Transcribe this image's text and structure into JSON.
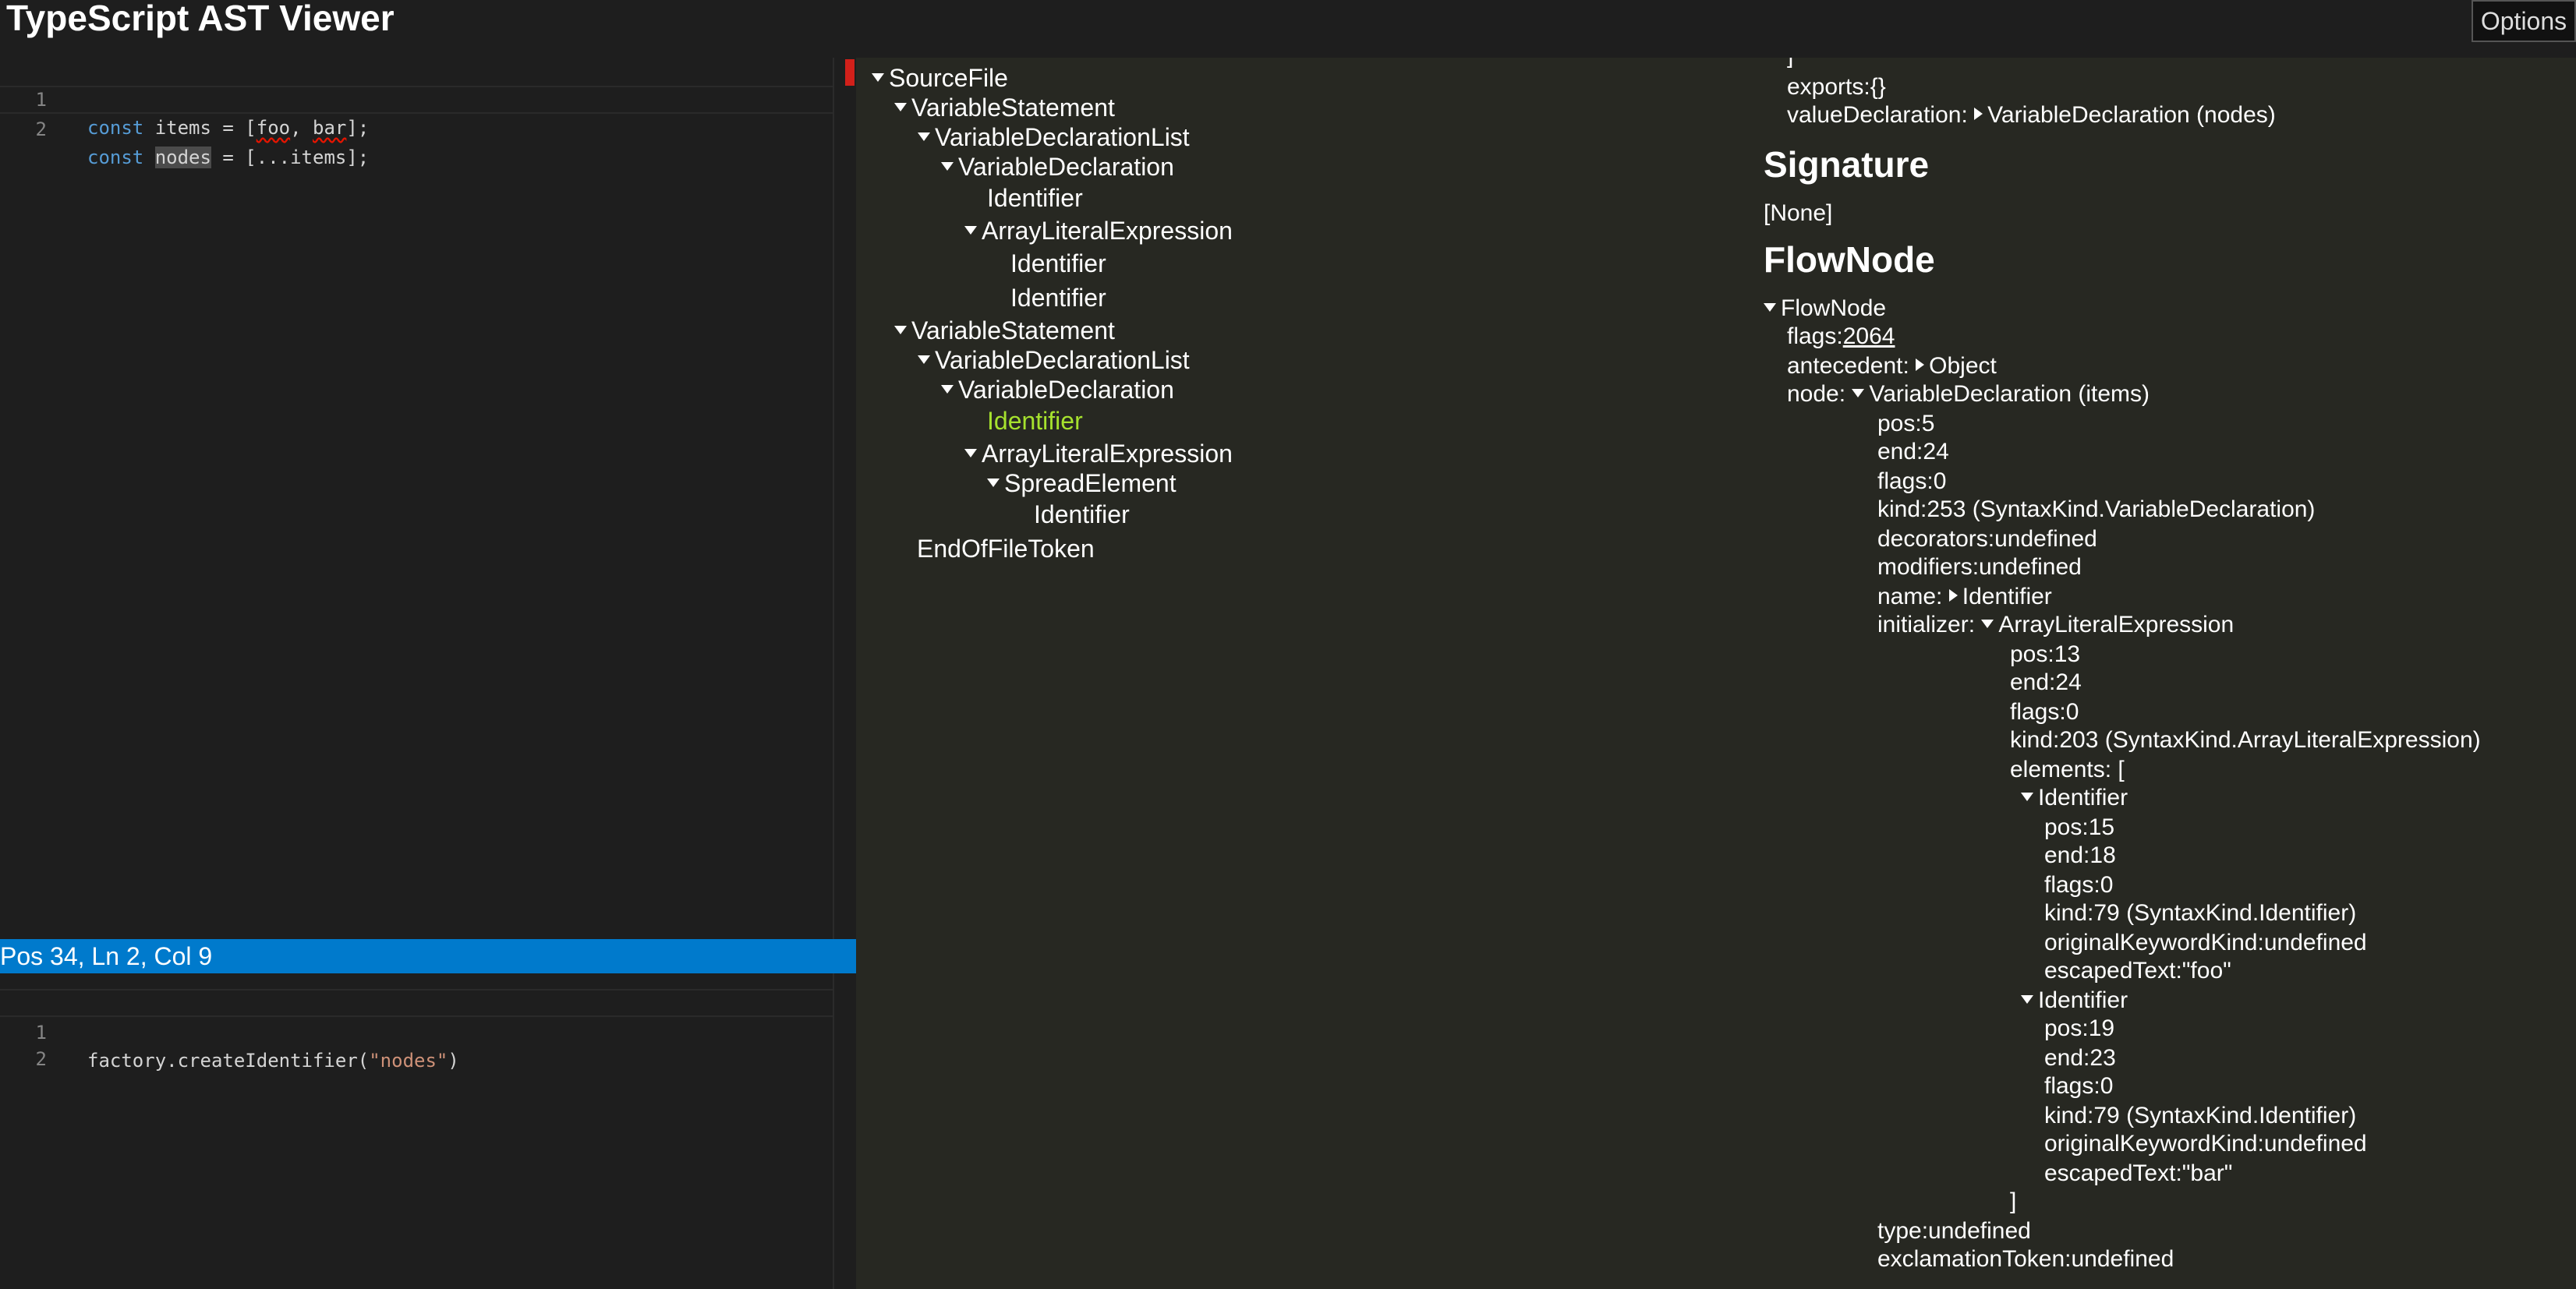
{
  "app": {
    "title": "TypeScript AST Viewer",
    "options_label": "Options"
  },
  "code_editor": {
    "lines": [
      {
        "num": "1",
        "kw": "const",
        "rest_a": " items = [",
        "id1": "foo",
        "sep": ", ",
        "id2": "bar",
        "end": "];"
      },
      {
        "num": "2",
        "kw": "const",
        "sp": " ",
        "hl": "nodes",
        "rest": " = [...items];"
      }
    ]
  },
  "status": {
    "position": "Pos 34, Ln 2, Col 9"
  },
  "factory_editor": {
    "lines": [
      {
        "num": "1",
        "call": "factory.createIdentifier(",
        "str": "\"nodes\"",
        "close": ")"
      },
      {
        "num": "2"
      }
    ]
  },
  "tree": {
    "nodes": [
      "SourceFile",
      "VariableStatement",
      "VariableDeclarationList",
      "VariableDeclaration",
      "Identifier",
      "ArrayLiteralExpression",
      "Identifier",
      "Identifier",
      "VariableStatement",
      "VariableDeclarationList",
      "VariableDeclaration",
      "Identifier",
      "ArrayLiteralExpression",
      "SpreadElement",
      "Identifier",
      "EndOfFileToken"
    ],
    "selected_index": 11
  },
  "props": {
    "top_bracket": "]",
    "exports_key": "exports:",
    "exports_val": "{}",
    "value_decl_key": "valueDeclaration:",
    "value_decl_val": "VariableDeclaration (nodes)",
    "signature_heading": "Signature",
    "signature_val": "[None]",
    "flownode_heading": "FlowNode",
    "flownode_root": "FlowNode",
    "flags_key": "flags:",
    "flags_val": "2064",
    "antecedent_key": "antecedent:",
    "antecedent_val": "Object",
    "node_key": "node:",
    "node_val": "VariableDeclaration (items)",
    "node_props": [
      {
        "k": "pos:",
        "v": "5"
      },
      {
        "k": "end:",
        "v": "24"
      },
      {
        "k": "flags:",
        "v": "0"
      },
      {
        "k": "kind:",
        "v": "253 (SyntaxKind.VariableDeclaration)"
      },
      {
        "k": "decorators:",
        "v": "undefined"
      },
      {
        "k": "modifiers:",
        "v": "undefined"
      }
    ],
    "name_key": "name:",
    "name_val": "Identifier",
    "initializer_key": "initializer:",
    "initializer_val": "ArrayLiteralExpression",
    "init_props": [
      {
        "k": "pos:",
        "v": "13"
      },
      {
        "k": "end:",
        "v": "24"
      },
      {
        "k": "flags:",
        "v": "0"
      },
      {
        "k": "kind:",
        "v": "203 (SyntaxKind.ArrayLiteralExpression)"
      }
    ],
    "elements_open": "elements: [",
    "elements": [
      {
        "label": "Identifier",
        "props": [
          {
            "k": "pos:",
            "v": "15"
          },
          {
            "k": "end:",
            "v": "18"
          },
          {
            "k": "flags:",
            "v": "0"
          },
          {
            "k": "kind:",
            "v": "79 (SyntaxKind.Identifier)"
          },
          {
            "k": "originalKeywordKind:",
            "v": "undefined"
          },
          {
            "k": "escapedText:",
            "v": "\"foo\""
          }
        ]
      },
      {
        "label": "Identifier",
        "props": [
          {
            "k": "pos:",
            "v": "19"
          },
          {
            "k": "end:",
            "v": "23"
          },
          {
            "k": "flags:",
            "v": "0"
          },
          {
            "k": "kind:",
            "v": "79 (SyntaxKind.Identifier)"
          },
          {
            "k": "originalKeywordKind:",
            "v": "undefined"
          },
          {
            "k": "escapedText:",
            "v": "\"bar\""
          }
        ]
      }
    ],
    "elements_close": "]",
    "tail_props": [
      {
        "k": "type:",
        "v": "undefined"
      },
      {
        "k": "exclamationToken:",
        "v": "undefined"
      }
    ]
  }
}
